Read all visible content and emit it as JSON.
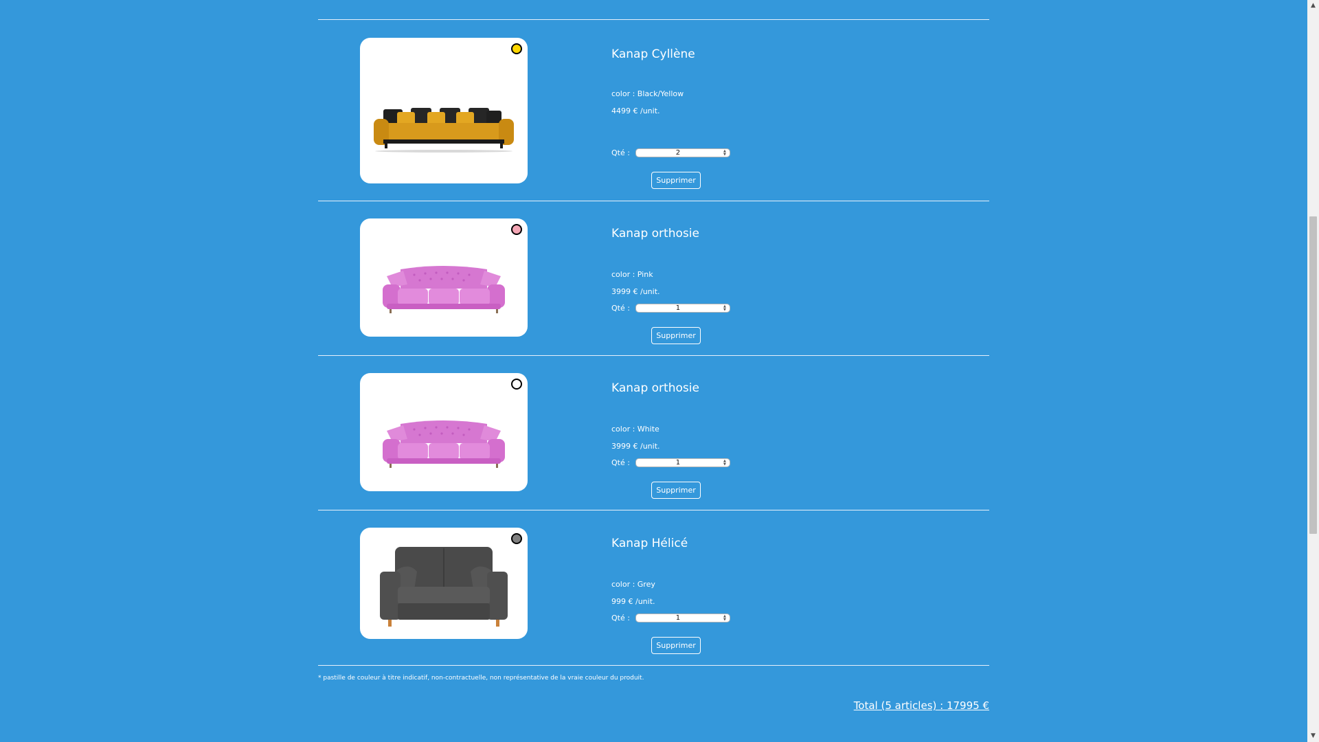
{
  "items": [
    {
      "name": "Kanap Cyllène",
      "color_text": "color : Black/Yellow",
      "price_text": "4499 € /unit.",
      "qty_label": "Qté :",
      "qty_value": "2",
      "delete_label": "Supprimer",
      "swatch_color": "#ffd700",
      "image": "yellow-sofa"
    },
    {
      "name": "Kanap orthosie",
      "color_text": "color : Pink",
      "price_text": "3999 € /unit.",
      "qty_label": "Qté :",
      "qty_value": "1",
      "delete_label": "Supprimer",
      "swatch_color": "#f4a6b5",
      "image": "pink-sofa"
    },
    {
      "name": "Kanap orthosie",
      "color_text": "color : White",
      "price_text": "3999 € /unit.",
      "qty_label": "Qté :",
      "qty_value": "1",
      "delete_label": "Supprimer",
      "swatch_color": "#ffffff",
      "image": "pink-sofa"
    },
    {
      "name": "Kanap Hélicé",
      "color_text": "color : Grey",
      "price_text": "999 € /unit.",
      "qty_label": "Qté :",
      "qty_value": "1",
      "delete_label": "Supprimer",
      "swatch_color": "#808080",
      "image": "grey-sofa"
    }
  ],
  "footnote": "* pastille de couleur à titre indicatif, non-contractuelle, non représentative de la vraie couleur du produit.",
  "total": "Total (5 articles) : 17995 €",
  "colors": {
    "background": "#3498db",
    "text": "#ffffff"
  }
}
